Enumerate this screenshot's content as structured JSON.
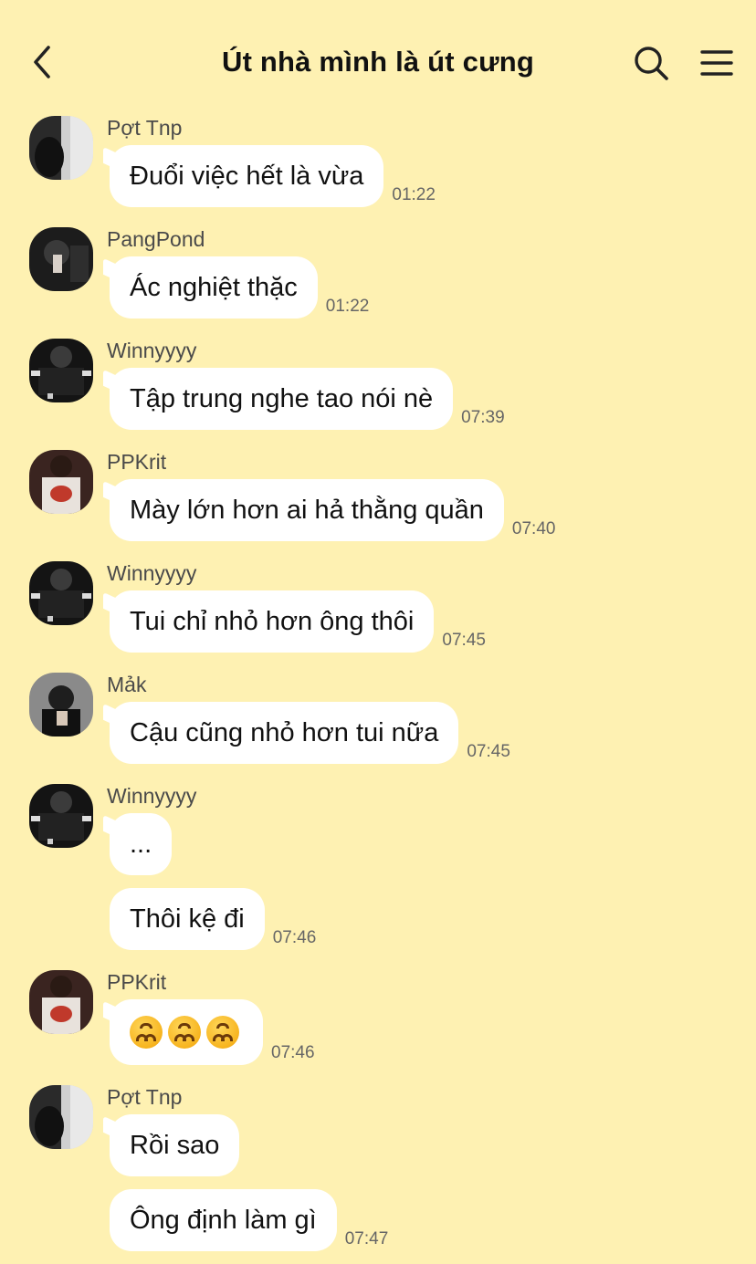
{
  "header": {
    "title": "Út nhà mình là út cưng",
    "back_icon": "chevron-left-icon",
    "search_icon": "search-icon",
    "menu_icon": "hamburger-menu-icon"
  },
  "messages": [
    {
      "sender": "Pợt Tnp",
      "bubbles": [
        "Đuổi việc hết là vừa"
      ],
      "time": "01:22"
    },
    {
      "sender": "PangPond",
      "bubbles": [
        "Ác nghiệt thặc"
      ],
      "time": "01:22"
    },
    {
      "sender": "Winnyyyy",
      "bubbles": [
        "Tập trung nghe tao nói nè"
      ],
      "time": "07:39"
    },
    {
      "sender": "PPKrit",
      "bubbles": [
        "Mày lớn hơn ai hả thằng quần"
      ],
      "time": "07:40"
    },
    {
      "sender": "Winnyyyy",
      "bubbles": [
        "Tui chỉ nhỏ hơn ông thôi"
      ],
      "time": "07:45"
    },
    {
      "sender": "Mảk",
      "bubbles": [
        "Cậu cũng nhỏ hơn tui nữa"
      ],
      "time": "07:45"
    },
    {
      "sender": "Winnyyyy",
      "bubbles": [
        "...",
        "Thôi kệ đi"
      ],
      "time": "07:46"
    },
    {
      "sender": "PPKrit",
      "bubbles": [
        "upside-down-face-emoji x3"
      ],
      "time": "07:46"
    },
    {
      "sender": "Pợt Tnp",
      "bubbles": [
        "Rồi sao",
        "Ông định làm gì"
      ],
      "time": "07:47"
    }
  ],
  "colors": {
    "background": "#FEF1B2",
    "bubble": "#FFFFFF",
    "text": "#111111",
    "meta": "#666666"
  }
}
